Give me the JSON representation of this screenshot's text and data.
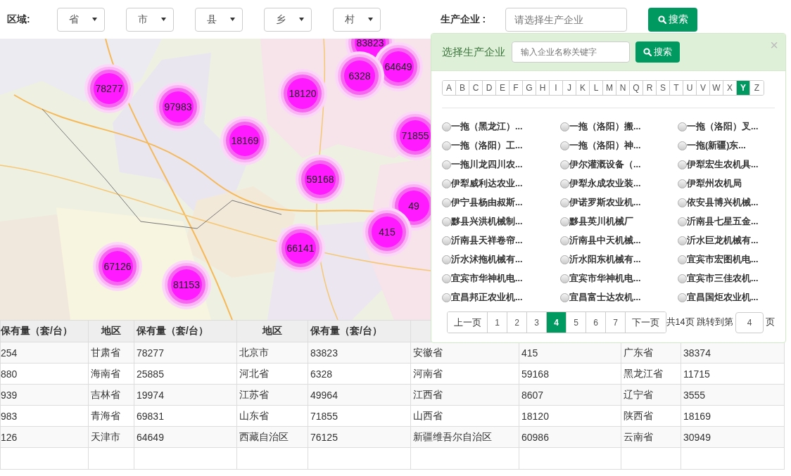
{
  "filters": {
    "region_label": "区域:",
    "selects": [
      "省",
      "市",
      "县",
      "乡",
      "村"
    ],
    "company_label": "生产企业 :",
    "company_placeholder": "请选择生产企业",
    "search_button": "搜索"
  },
  "map": {
    "markers": [
      {
        "label": "83823"
      },
      {
        "label": "64649"
      },
      {
        "label": "6328"
      },
      {
        "label": "78277"
      },
      {
        "label": "18120"
      },
      {
        "label": "97983"
      },
      {
        "label": "18169"
      },
      {
        "label": "71855"
      },
      {
        "label": "59168"
      },
      {
        "label": "49"
      },
      {
        "label": "415"
      },
      {
        "label": "66141"
      },
      {
        "label": "67126"
      },
      {
        "label": "81153"
      }
    ]
  },
  "table": {
    "columns": [
      "保有量（套/台）",
      "地区",
      "保有量（套/台）",
      "地区",
      "保有量（套/台）"
    ],
    "rows": [
      [
        "254",
        "甘肃省",
        "78277",
        "北京市",
        "83823",
        "安徽省",
        "415",
        "广东省",
        "38374"
      ],
      [
        "880",
        "海南省",
        "25885",
        "河北省",
        "6328",
        "河南省",
        "59168",
        "黑龙江省",
        "11715"
      ],
      [
        "939",
        "吉林省",
        "19974",
        "江苏省",
        "49964",
        "江西省",
        "8607",
        "辽宁省",
        "3555"
      ],
      [
        "983",
        "青海省",
        "69831",
        "山东省",
        "71855",
        "山西省",
        "18120",
        "陕西省",
        "18169"
      ],
      [
        "126",
        "天津市",
        "64649",
        "西藏自治区",
        "76125",
        "新疆维吾尔自治区",
        "60986",
        "云南省",
        "30949"
      ]
    ]
  },
  "popup": {
    "title": "选择生产企业",
    "search_placeholder": "输入企业名称关键字",
    "search_button": "搜索",
    "close": "×",
    "letters": [
      {
        "label": "A",
        "selected": false
      },
      {
        "label": "B",
        "selected": false
      },
      {
        "label": "C",
        "selected": false
      },
      {
        "label": "D",
        "selected": false
      },
      {
        "label": "E",
        "selected": false
      },
      {
        "label": "F",
        "selected": false
      },
      {
        "label": "G",
        "selected": false
      },
      {
        "label": "H",
        "selected": false
      },
      {
        "label": "I",
        "selected": false
      },
      {
        "label": "J",
        "selected": false
      },
      {
        "label": "K",
        "selected": false
      },
      {
        "label": "L",
        "selected": false
      },
      {
        "label": "M",
        "selected": false
      },
      {
        "label": "N",
        "selected": false
      },
      {
        "label": "Q",
        "selected": false
      },
      {
        "label": "R",
        "selected": false
      },
      {
        "label": "S",
        "selected": false
      },
      {
        "label": "T",
        "selected": false
      },
      {
        "label": "U",
        "selected": false
      },
      {
        "label": "V",
        "selected": false
      },
      {
        "label": "W",
        "selected": false
      },
      {
        "label": "X",
        "selected": false
      },
      {
        "label": "Y",
        "selected": true
      },
      {
        "label": "Z",
        "selected": false
      }
    ],
    "companies": [
      {
        "name": "一拖（黑龙江）...",
        "selected": false
      },
      {
        "name": "一拖（洛阳）搬...",
        "selected": false
      },
      {
        "name": "一拖（洛阳）叉...",
        "selected": false
      },
      {
        "name": "一拖（洛阳）工...",
        "selected": false
      },
      {
        "name": "一拖（洛阳）神...",
        "selected": false
      },
      {
        "name": "一拖(新疆)东...",
        "selected": false
      },
      {
        "name": "一拖川龙四川农...",
        "selected": false
      },
      {
        "name": "伊尔灌溉设备（...",
        "selected": false
      },
      {
        "name": "伊犁宏生农机具...",
        "selected": false
      },
      {
        "name": "伊犁威利达农业...",
        "selected": false
      },
      {
        "name": "伊犁永成农业装...",
        "selected": false
      },
      {
        "name": "伊犁州农机局",
        "selected": false
      },
      {
        "name": "伊宁县杨由叔斯...",
        "selected": false
      },
      {
        "name": "伊诺罗斯农业机...",
        "selected": false
      },
      {
        "name": "依安县博兴机械...",
        "selected": false
      },
      {
        "name": "黟县兴洪机械制...",
        "selected": false
      },
      {
        "name": "黟县英川机械厂",
        "selected": false
      },
      {
        "name": "沂南县七星五金...",
        "selected": false
      },
      {
        "name": "沂南县天祥卷帘...",
        "selected": false
      },
      {
        "name": "沂南县中天机械...",
        "selected": false
      },
      {
        "name": "沂水巨龙机械有...",
        "selected": false
      },
      {
        "name": "沂水沭拖机械有...",
        "selected": false
      },
      {
        "name": "沂水阳东机械有...",
        "selected": false
      },
      {
        "name": "宜宾市宏图机电...",
        "selected": false
      },
      {
        "name": "宜宾市华神机电...",
        "selected": false
      },
      {
        "name": "宜宾市华神机电...",
        "selected": false
      },
      {
        "name": "宜宾市三佳农机...",
        "selected": false
      },
      {
        "name": "宜昌邦正农业机...",
        "selected": false
      },
      {
        "name": "宜昌富士达农机...",
        "selected": false
      },
      {
        "name": "宜昌国炬农业机...",
        "selected": false
      }
    ],
    "pagination": {
      "prev": "上一页",
      "pages": [
        {
          "label": "1",
          "selected": false
        },
        {
          "label": "2",
          "selected": false
        },
        {
          "label": "3",
          "selected": false
        },
        {
          "label": "4",
          "selected": true
        },
        {
          "label": "5",
          "selected": false
        },
        {
          "label": "6",
          "selected": false
        },
        {
          "label": "7",
          "selected": false
        }
      ],
      "next": "下一页",
      "total_text": "共14页 跳转到第",
      "jump_value": "4",
      "suffix": "页"
    }
  }
}
